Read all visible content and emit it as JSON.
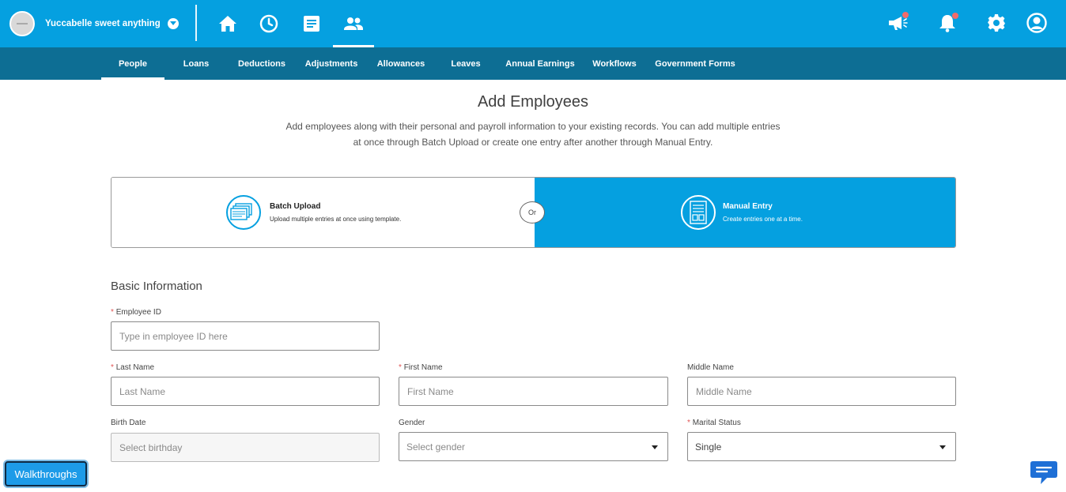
{
  "topbar": {
    "company_name": "Yuccabelle sweet anything",
    "icons": [
      "home-icon",
      "clock-icon",
      "document-icon",
      "people-icon",
      "megaphone-icon",
      "bell-icon",
      "gear-icon",
      "account-icon"
    ]
  },
  "subnav": {
    "items": [
      "People",
      "Loans",
      "Deductions",
      "Adjustments",
      "Allowances",
      "Leaves",
      "Annual Earnings",
      "Workflows",
      "Government Forms"
    ],
    "active": "People"
  },
  "header": {
    "title": "Add Employees",
    "description_line1": "Add employees along with their personal and payroll information to your existing records. You can add multiple entries",
    "description_line2": "at once through Batch Upload or create one entry after another through Manual Entry."
  },
  "modes": {
    "batch": {
      "title": "Batch Upload",
      "subtitle": "Upload multiple entries at once using template."
    },
    "or_label": "Or",
    "manual": {
      "title": "Manual Entry",
      "subtitle": "Create entries one at a time."
    },
    "selected": "Manual Entry"
  },
  "form": {
    "section_title": "Basic Information",
    "required_mark": "*",
    "employee_id": {
      "label": "Employee ID",
      "placeholder": "Type in employee ID here"
    },
    "last_name": {
      "label": "Last Name",
      "placeholder": "Last Name"
    },
    "first_name": {
      "label": "First Name",
      "placeholder": "First Name"
    },
    "middle_name": {
      "label": "Middle Name",
      "placeholder": "Middle Name"
    },
    "birth_date": {
      "label": "Birth Date",
      "placeholder": "Select birthday"
    },
    "gender": {
      "label": "Gender",
      "placeholder": "Select gender"
    },
    "marital_status": {
      "label": "Marital Status",
      "value": "Single"
    }
  },
  "widgets": {
    "walkthroughs_label": "Walkthroughs",
    "chat_icon": "chat-icon"
  },
  "colors": {
    "primary": "#05a0e0",
    "subnav": "#0d6e94",
    "required": "#e05555",
    "notification_dot": "#f26b6b"
  }
}
